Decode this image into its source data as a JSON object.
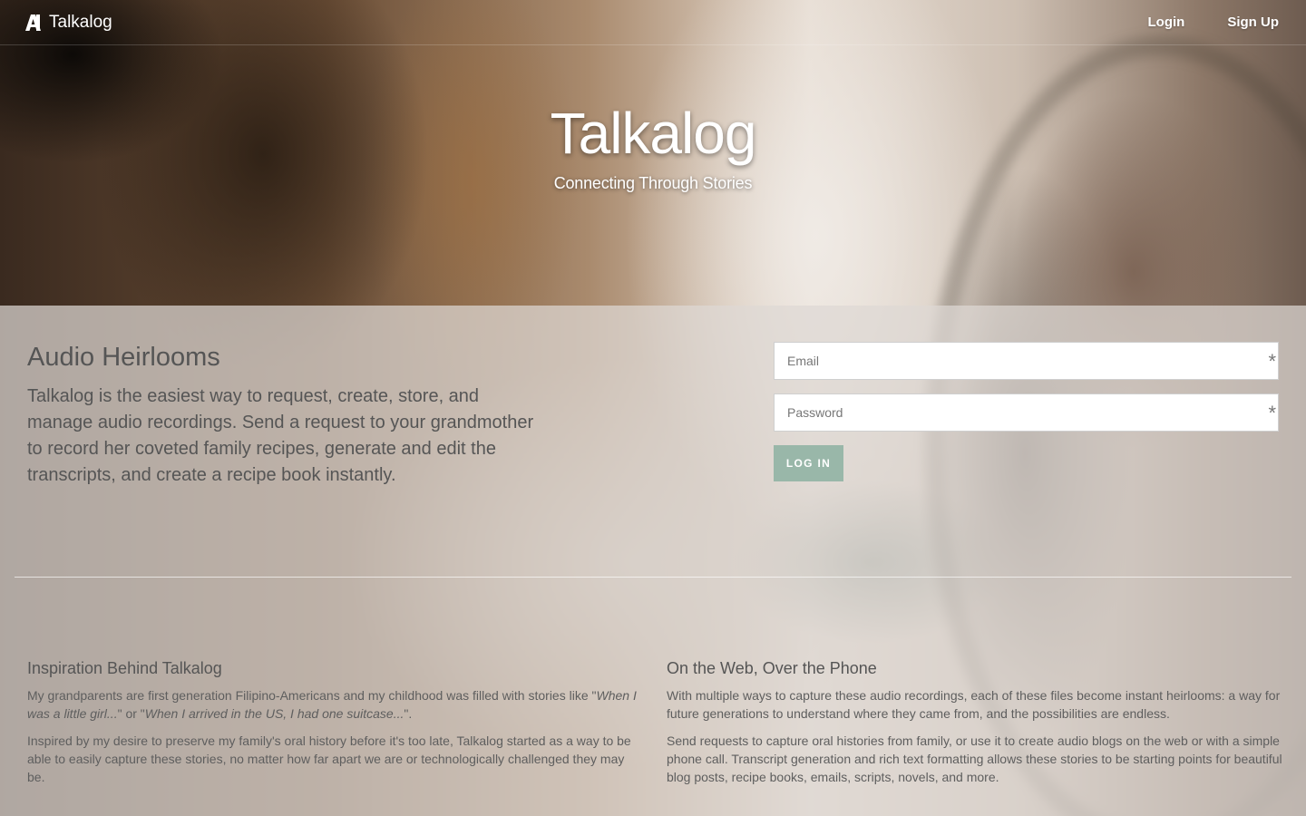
{
  "navbar": {
    "brand": "Talkalog",
    "links": [
      {
        "label": "Login"
      },
      {
        "label": "Sign Up"
      }
    ]
  },
  "hero": {
    "title": "Talkalog",
    "subtitle": "Connecting Through Stories"
  },
  "about": {
    "heading": "Audio Heirlooms",
    "body": "Talkalog is the easiest way to request, create, store, and manage audio recordings. Send a request to your grandmother to record her coveted family recipes, generate and edit the transcripts, and create a recipe book instantly."
  },
  "login": {
    "email_placeholder": "Email",
    "password_placeholder": "Password",
    "required_mark": "*",
    "button_label": "LOG IN",
    "button_color": "#99b7a9"
  },
  "sections": {
    "inspiration": {
      "title": "Inspiration Behind Talkalog",
      "p1_start": "My grandparents are first generation Filipino-Americans and my childhood was filled with stories like \"",
      "p1_quote1": "When I was a little girl...",
      "p1_mid": "\" or \"",
      "p1_quote2": "When I arrived in the US, I had one suitcase...",
      "p1_end": "\".",
      "p2": "Inspired by my desire to preserve my family's oral history before it's too late, Talkalog started as a way to be able to easily capture these stories, no matter how far apart we are or technologically challenged they may be."
    },
    "web_phone": {
      "title": "On the Web, Over the Phone",
      "p1": "With multiple ways to capture these audio recordings, each of these files become instant heirlooms: a way for future generations to understand where they came from, and the possibilities are endless.",
      "p2": "Send requests to capture oral histories from family, or use it to create audio blogs on the web or with a simple phone call. Transcript generation and rich text formatting allows these stories to be starting points for beautiful blog posts, recipe books, emails, scripts, novels, and more."
    }
  }
}
